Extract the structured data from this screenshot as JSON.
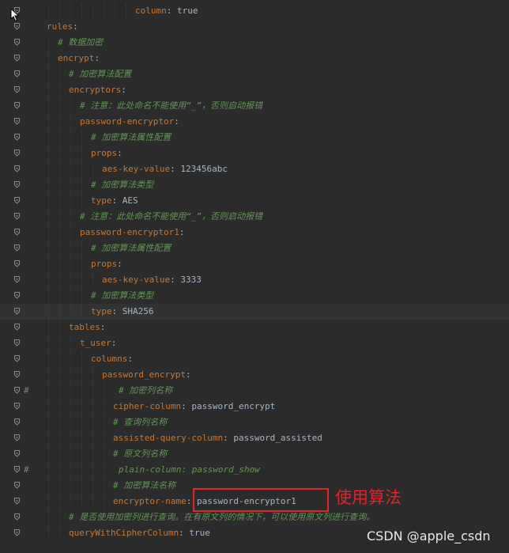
{
  "editor": {
    "lines": [
      {
        "indent": 8,
        "kind": "kv",
        "key": "column",
        "value": "true"
      },
      {
        "indent": 0,
        "kind": "key",
        "key": "rules"
      },
      {
        "indent": 1,
        "kind": "comment",
        "text": "# 数据加密"
      },
      {
        "indent": 1,
        "kind": "key",
        "key": "encrypt"
      },
      {
        "indent": 2,
        "kind": "comment",
        "text": "# 加密算法配置"
      },
      {
        "indent": 2,
        "kind": "key",
        "key": "encryptors"
      },
      {
        "indent": 3,
        "kind": "comment",
        "text": "# 注意：此处命名不能使用“_”，否则启动报错"
      },
      {
        "indent": 3,
        "kind": "key",
        "key": "password-encryptor"
      },
      {
        "indent": 4,
        "kind": "comment",
        "text": "# 加密算法属性配置"
      },
      {
        "indent": 4,
        "kind": "key",
        "key": "props"
      },
      {
        "indent": 5,
        "kind": "kv",
        "key": "aes-key-value",
        "value": "123456abc"
      },
      {
        "indent": 4,
        "kind": "comment",
        "text": "# 加密算法类型"
      },
      {
        "indent": 4,
        "kind": "kv",
        "key": "type",
        "value": "AES"
      },
      {
        "indent": 3,
        "kind": "comment",
        "text": "# 注意：此处命名不能使用“_”，否则启动报错"
      },
      {
        "indent": 3,
        "kind": "key",
        "key": "password-encryptor1"
      },
      {
        "indent": 4,
        "kind": "comment",
        "text": "# 加密算法属性配置"
      },
      {
        "indent": 4,
        "kind": "key",
        "key": "props"
      },
      {
        "indent": 5,
        "kind": "kv",
        "key": "aes-key-value",
        "value": "3333"
      },
      {
        "indent": 4,
        "kind": "comment",
        "text": "# 加密算法类型"
      },
      {
        "indent": 4,
        "kind": "kv",
        "key": "type",
        "value": "SHA256",
        "highlight": true
      },
      {
        "indent": 2,
        "kind": "key",
        "key": "tables"
      },
      {
        "indent": 3,
        "kind": "key",
        "key": "t_user"
      },
      {
        "indent": 4,
        "kind": "key",
        "key": "columns"
      },
      {
        "indent": 5,
        "kind": "key",
        "key": "password_encrypt"
      },
      {
        "indent": 6.5,
        "kind": "comment",
        "text": "# 加密列名称",
        "prefix": "#"
      },
      {
        "indent": 6,
        "kind": "kv",
        "key": "cipher-column",
        "value": "password_encrypt"
      },
      {
        "indent": 6,
        "kind": "comment",
        "text": "# 查询列名称"
      },
      {
        "indent": 6,
        "kind": "kv",
        "key": "assisted-query-column",
        "value": "password_assisted"
      },
      {
        "indent": 6,
        "kind": "comment",
        "text": "# 原文列名称"
      },
      {
        "indent": 6.5,
        "kind": "commentkv",
        "text": "plain-column: password_show",
        "prefix": "#"
      },
      {
        "indent": 6,
        "kind": "comment",
        "text": "# 加密算法名称"
      },
      {
        "indent": 6,
        "kind": "kv",
        "key": "encryptor-name",
        "value": "password-encryptor1"
      },
      {
        "indent": 2,
        "kind": "comment",
        "text": "# 是否使用加密列进行查询。在有原文列的情况下，可以使用原文列进行查询。"
      },
      {
        "indent": 2,
        "kind": "kv",
        "key": "queryWithCipherColumn",
        "value": "true"
      }
    ]
  },
  "annotation": {
    "label": "使用算法"
  },
  "watermark": {
    "text": "CSDN @apple_csdn"
  },
  "colors": {
    "key": "#cc7832",
    "comment": "#629755",
    "value": "#a9b7c6",
    "background": "#2b2b2b",
    "highlight": "#e0242a"
  }
}
